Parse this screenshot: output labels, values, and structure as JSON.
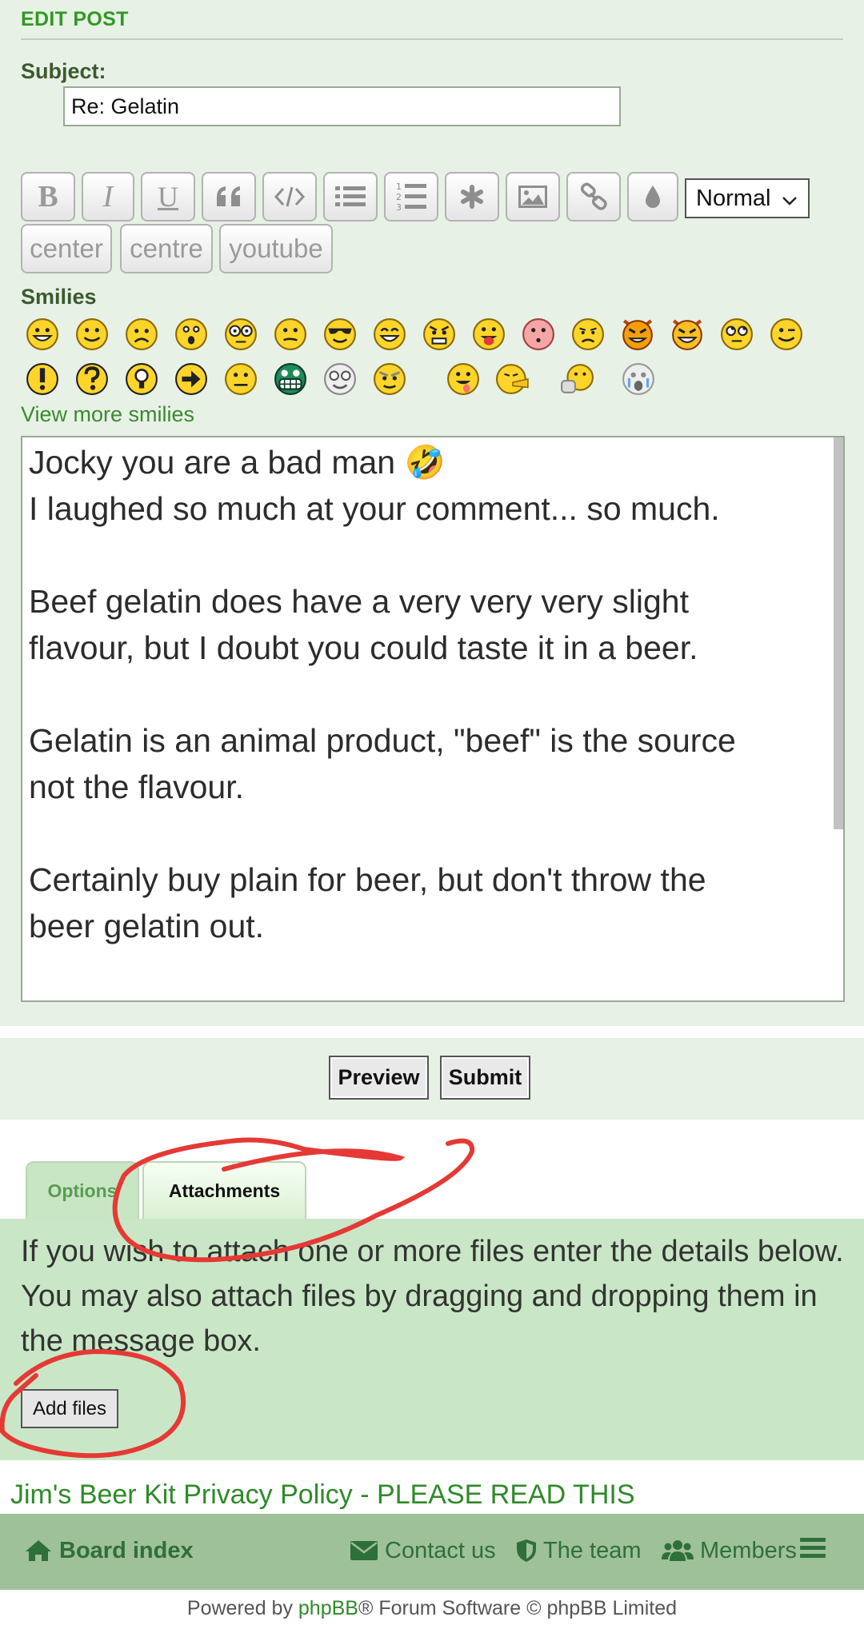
{
  "header": {
    "title": "EDIT POST"
  },
  "subject": {
    "label": "Subject:",
    "value": "Re: Gelatin"
  },
  "toolbar": {
    "buttons": [
      "bold-icon",
      "italic-icon",
      "underline-icon",
      "quote-icon",
      "code-icon",
      "list-icon",
      "ordered-list-icon",
      "asterisk-icon",
      "image-icon",
      "link-icon",
      "color-drop-icon"
    ],
    "font_size": "Normal",
    "custom": [
      "center",
      "centre",
      "youtube"
    ]
  },
  "smilies": {
    "label": "Smilies",
    "view_more": "View more smilies",
    "icons": [
      "grin",
      "smile",
      "sad",
      "surprised",
      "eek",
      "confused",
      "cool",
      "laughing",
      "mad",
      "razz",
      "embarrassed",
      "crying",
      "evil",
      "twisted",
      "rolleyes",
      "wink",
      "exclaim",
      "question",
      "idea",
      "arrow",
      "neutral",
      "mrgreen",
      "geek",
      "ugeek",
      "drool",
      "puke",
      "sick",
      "cry"
    ]
  },
  "message": {
    "lines": [
      "Jocky you are a bad man 🤣",
      "I laughed so much at your comment... so much.",
      "",
      "Beef gelatin does have a very very very slight",
      "flavour, but I doubt you could taste it in a beer.",
      "",
      "Gelatin is an animal product, \"beef\" is the source",
      "not the flavour.",
      "",
      "Certainly buy plain for beer, but don't throw the",
      "beer gelatin out."
    ]
  },
  "buttons": {
    "preview": "Preview",
    "submit": "Submit"
  },
  "tabs": {
    "options": "Options",
    "attachments": "Attachments"
  },
  "attachments": {
    "info": "If you wish to attach one or more files enter the details below. You may also attach files by dragging and dropping them in the message box.",
    "add_files": "Add files"
  },
  "privacy_link": "Jim's Beer Kit Privacy Policy - PLEASE READ THIS",
  "footer": {
    "board_index": "Board index",
    "contact": "Contact us",
    "team": "The team",
    "members": "Members"
  },
  "powered": {
    "prefix": "Powered by ",
    "phpbb": "phpBB",
    "suffix": "® Forum Software © phpBB Limited"
  },
  "colors": {
    "accent_green": "#2f9a22",
    "panel_bg": "#e8f1e6",
    "attach_bg": "#c9e7c6",
    "footer_bg": "#9ec19a",
    "annotation_red": "#e53935"
  }
}
